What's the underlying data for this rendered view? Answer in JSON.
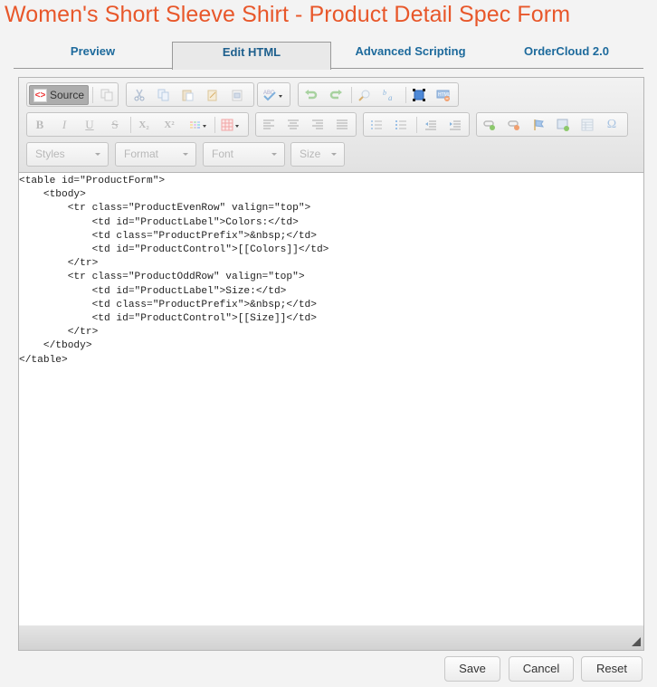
{
  "page": {
    "title": "Women's Short Sleeve Shirt - Product Detail Spec Form"
  },
  "tabs": [
    {
      "label": "Preview",
      "active": false
    },
    {
      "label": "Edit HTML",
      "active": true
    },
    {
      "label": "Advanced Scripting",
      "active": false
    },
    {
      "label": "OrderCloud 2.0",
      "active": false
    }
  ],
  "toolbar": {
    "source_label": "Source",
    "combos": {
      "styles": "Styles",
      "format": "Format",
      "font": "Font",
      "size": "Size"
    },
    "icons": {
      "row1": [
        "source-icon",
        "templates-icon",
        "cut-icon",
        "copy-icon",
        "paste-icon",
        "paste-text-icon",
        "paste-word-icon",
        "spellcheck-icon",
        "undo-icon",
        "redo-icon",
        "find-icon",
        "replace-icon",
        "select-all-icon",
        "remove-format-icon"
      ],
      "row2": [
        "bold-icon",
        "italic-icon",
        "underline-icon",
        "strike-icon",
        "subscript-icon",
        "superscript-icon",
        "text-color-icon",
        "table-icon",
        "align-left-icon",
        "align-center-icon",
        "align-right-icon",
        "justify-icon",
        "numbered-list-icon",
        "bulleted-list-icon",
        "outdent-icon",
        "indent-icon",
        "link-icon",
        "unlink-icon",
        "anchor-icon",
        "image-icon",
        "insert-table-icon",
        "special-char-icon"
      ]
    },
    "glyphs": {
      "bold": "B",
      "italic": "I",
      "underline": "U",
      "strike": "S",
      "subscript": "X₂",
      "superscript": "X²",
      "omega": "Ω"
    }
  },
  "editor": {
    "code_lines": [
      "<table id=\"ProductForm\">",
      "    <tbody>",
      "        <tr class=\"ProductEvenRow\" valign=\"top\">",
      "            <td id=\"ProductLabel\">Colors:</td>",
      "            <td class=\"ProductPrefix\">&nbsp;</td>",
      "            <td id=\"ProductControl\">[[Colors]]</td>",
      "        </tr>",
      "        <tr class=\"ProductOddRow\" valign=\"top\">",
      "            <td id=\"ProductLabel\">Size:</td>",
      "            <td class=\"ProductPrefix\">&nbsp;</td>",
      "            <td id=\"ProductControl\">[[Size]]</td>",
      "        </tr>",
      "    </tbody>",
      "</table>"
    ]
  },
  "actions": {
    "save": "Save",
    "cancel": "Cancel",
    "reset": "Reset"
  },
  "colors": {
    "title": "#e8572a",
    "tab_text": "#1d6a9c"
  }
}
